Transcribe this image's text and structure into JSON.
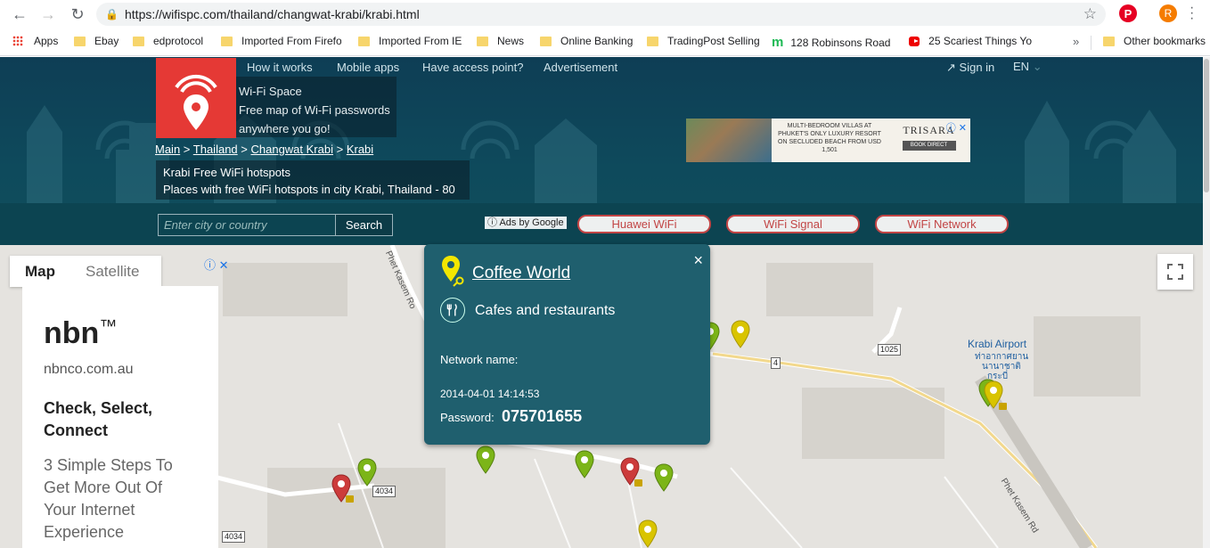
{
  "browser": {
    "url": "https://wifispc.com/thailand/changwat-krabi/krabi.html",
    "profile_initial": "R",
    "bookmarks": [
      {
        "label": "Apps",
        "icon": "apps-grid-icon"
      },
      {
        "label": "Ebay",
        "icon": "folder-icon"
      },
      {
        "label": "edprotocol",
        "icon": "folder-icon"
      },
      {
        "label": "Imported From Firefo",
        "icon": "folder-icon"
      },
      {
        "label": "Imported From IE",
        "icon": "folder-icon"
      },
      {
        "label": "News",
        "icon": "folder-icon"
      },
      {
        "label": "Online Banking",
        "icon": "folder-icon"
      },
      {
        "label": "TradingPost Selling",
        "icon": "folder-icon"
      },
      {
        "label": "128 Robinsons Road",
        "icon": "m-icon"
      },
      {
        "label": "25 Scariest Things Yo",
        "icon": "youtube-icon"
      }
    ],
    "overflow": "»",
    "other_bookmarks": "Other bookmarks"
  },
  "site": {
    "nav": [
      "How it works",
      "Mobile apps",
      "Have access point?",
      "Advertisement"
    ],
    "brand": "Wi-Fi Space",
    "tagline_1": "Free map of Wi-Fi passwords",
    "tagline_2": "anywhere you go!",
    "signin": "Sign in",
    "lang": "EN",
    "breadcrumbs": [
      "Main",
      "Thailand",
      "Changwat Krabi",
      "Krabi"
    ],
    "breadcrumb_sep": " > ",
    "page_title": "Krabi Free WiFi hotspots",
    "page_subtitle": "Places with free WiFi hotspots in city Krabi, Thailand - 80",
    "search_placeholder": "Enter  city or country",
    "search_button": "Search",
    "ads_by_google": "Ads by Google",
    "ad_links": [
      "Huawei WiFi",
      "WiFi Signal",
      "WiFi Network"
    ]
  },
  "banner_ad": {
    "text": "MULTI-BEDROOM VILLAS AT PHUKET'S ONLY LUXURY RESORT ON SECLUDED BEACH FROM USD 1,501",
    "brand": "TRISARA",
    "cta": "BOOK DIRECT"
  },
  "map": {
    "tabs": [
      "Map",
      "Satellite"
    ],
    "active_tab": "Map",
    "airport_label_en": "Krabi Airport",
    "airport_label_th_1": "ท่าอากาศยาน",
    "airport_label_th_2": "นานาชาติ",
    "airport_label_th_3": "กระบี่",
    "road_4": "4",
    "road_1025": "1025",
    "road_4034_a": "4034",
    "road_4034_b": "4034",
    "road_name_1": "Phet Kasem Rd",
    "road_name_2": "Phet Kasem Ro",
    "pin_colors": {
      "yellow": "#d9c400",
      "green": "#7cb518",
      "red": "#cc3b3b"
    }
  },
  "nbn_ad": {
    "brand": "nbn",
    "tm": "™",
    "domain": "nbnco.com.au",
    "headline": "Check, Select, Connect",
    "body": "3 Simple Steps To Get More Out Of Your Internet Experience"
  },
  "popup": {
    "title": "Coffee World",
    "category": "Cafes and restaurants",
    "network_label": "Network name:",
    "date": "2014-04-01 14:14:53",
    "password_label": "Password:",
    "password": "075701655",
    "close": "×"
  }
}
